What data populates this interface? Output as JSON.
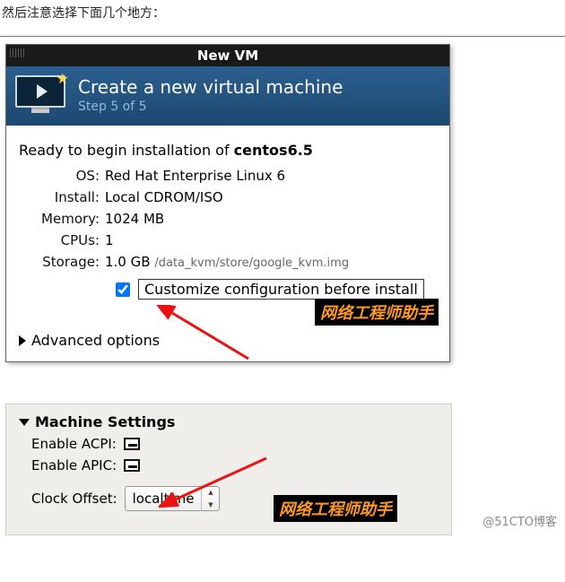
{
  "intro_text": "然后注意选择下面几个地方：",
  "dialog1": {
    "window_title": "New VM",
    "banner_title": "Create a new virtual machine",
    "banner_step": "Step 5 of 5",
    "ready_prefix": "Ready to begin installation of ",
    "vm_name": "centos6.5",
    "os_label": "OS:",
    "os_value": "Red Hat Enterprise Linux 6",
    "install_label": "Install:",
    "install_value": "Local CDROM/ISO",
    "memory_label": "Memory:",
    "memory_value": "1024 MB",
    "cpus_label": "CPUs:",
    "cpus_value": "1",
    "storage_label": "Storage:",
    "storage_value": "1.0 GB",
    "storage_path": "/data_kvm/store/google_kvm.img",
    "customize_label": "Customize configuration before install",
    "advanced_label": "Advanced options",
    "watermark": "网络工程师助手"
  },
  "dialog2": {
    "section_title": "Machine Settings",
    "acpi_label": "Enable ACPI:",
    "apic_label": "Enable APIC:",
    "clock_label": "Clock Offset:",
    "clock_value": "localtime",
    "watermark": "网络工程师助手",
    "credit": "@51CTO博客"
  }
}
